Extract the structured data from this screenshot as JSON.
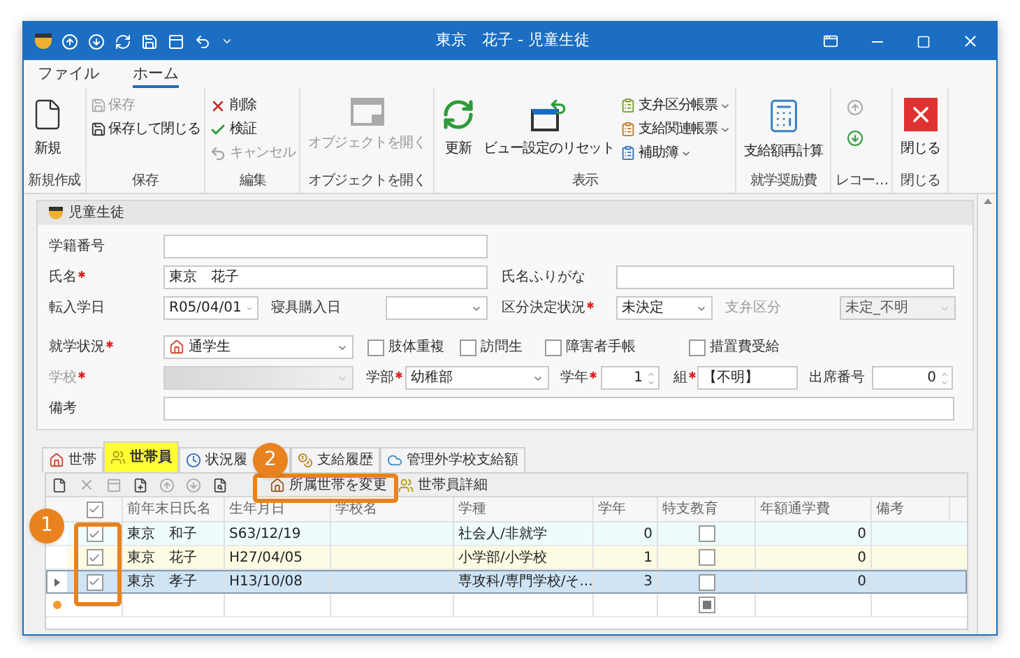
{
  "window": {
    "title": "東京　花子 - 児童生徒"
  },
  "menu_tabs": [
    {
      "label": "ファイル",
      "selected": false
    },
    {
      "label": "ホーム",
      "selected": true
    }
  ],
  "ribbon": [
    {
      "label": "新規作成",
      "items": [
        {
          "label": "新規",
          "kind": "large",
          "disabled": false
        }
      ]
    },
    {
      "label": "保存",
      "items": [
        {
          "label": "保存",
          "kind": "small",
          "disabled": true
        },
        {
          "label": "保存して閉じる",
          "kind": "small",
          "disabled": false
        }
      ]
    },
    {
      "label": "編集",
      "items": [
        {
          "label": "削除",
          "kind": "small",
          "disabled": false
        },
        {
          "label": "検証",
          "kind": "small",
          "disabled": false
        },
        {
          "label": "キャンセル",
          "kind": "small",
          "disabled": true
        }
      ]
    },
    {
      "label": "オブジェクトを開く",
      "items": [
        {
          "label": "オブジェクトを開く",
          "kind": "large",
          "disabled": true
        }
      ]
    },
    {
      "label": "表示",
      "items": [
        {
          "label": "更新",
          "kind": "large",
          "disabled": false
        },
        {
          "label": "ビュー設定のリセット",
          "kind": "large",
          "disabled": false
        },
        {
          "label": "支弁区分帳票",
          "kind": "small",
          "disabled": false,
          "dropdown": true
        },
        {
          "label": "支給関連帳票",
          "kind": "small",
          "disabled": false,
          "dropdown": true
        },
        {
          "label": "補助簿",
          "kind": "small",
          "disabled": false,
          "dropdown": true
        }
      ]
    },
    {
      "label": "就学奨励費",
      "items": [
        {
          "label": "支給額再計算",
          "kind": "large",
          "disabled": false
        }
      ]
    },
    {
      "label": "レコー…",
      "items": [
        {
          "kind": "iconsmall",
          "disabled": true
        },
        {
          "kind": "iconsmall",
          "disabled": false
        }
      ]
    },
    {
      "label": "閉じる",
      "items": [
        {
          "label": "閉じる",
          "kind": "large",
          "disabled": false
        }
      ]
    }
  ],
  "form": {
    "title": "児童生徒",
    "student_number": {
      "label": "学籍番号"
    },
    "name": {
      "label": "氏名",
      "required": true,
      "value": "東京　花子"
    },
    "name_kana": {
      "label": "氏名ふりがな"
    },
    "transfer_date": {
      "label": "転入学日",
      "value": "R05/04/01"
    },
    "bedding_date": {
      "label": "寝具購入日"
    },
    "category_status": {
      "label": "区分決定状況",
      "required": true,
      "value": "未決定"
    },
    "payment_category": {
      "label": "支弁区分",
      "value": "未定_不明",
      "disabled": true
    },
    "enrollment": {
      "label": "就学状況",
      "required": true,
      "value": "通学生"
    },
    "checks": [
      {
        "label": "肢体重複",
        "checked": false
      },
      {
        "label": "訪問生",
        "checked": false
      },
      {
        "label": "障害者手帳",
        "checked": false
      },
      {
        "label": "措置費受給",
        "checked": false
      }
    ],
    "school": {
      "label": "学校",
      "required": true,
      "disabled": true
    },
    "department": {
      "label": "学部",
      "required": true,
      "value": "幼稚部"
    },
    "grade": {
      "label": "学年",
      "required": true,
      "value": "1"
    },
    "class": {
      "label": "組",
      "required": true,
      "value": "【不明】"
    },
    "seat": {
      "label": "出席番号",
      "value": "0"
    },
    "notes": {
      "label": "備考"
    }
  },
  "sub_tabs": [
    {
      "label": "世帯",
      "selected": false
    },
    {
      "label": "世帯員",
      "selected": true
    },
    {
      "label": "状況履",
      "selected": false
    },
    {
      "label": "支給履歴",
      "selected": false
    },
    {
      "label": "管理外学校支給額",
      "selected": false
    }
  ],
  "toolbar": {
    "buttons": [
      {
        "label": "所属世帯を変更"
      },
      {
        "label": "世帯員詳細"
      }
    ]
  },
  "grid": {
    "header_checked": true,
    "columns": [
      "前年末日氏名",
      "生年月日",
      "学校名",
      "学種",
      "学年",
      "特支教育",
      "年額通学費",
      "備考"
    ],
    "rows": [
      {
        "checked": true,
        "selected": false,
        "color": "#eefcfd",
        "cells": [
          "東京　和子",
          "S63/12/19",
          "",
          "社会人/非就学",
          "0"
        ],
        "special_ed": false,
        "fee": "0"
      },
      {
        "checked": true,
        "selected": false,
        "color": "#fdfbe3",
        "cells": [
          "東京　花子",
          "H27/04/05",
          "",
          "小学部/小学校",
          "1"
        ],
        "special_ed": false,
        "fee": "0"
      },
      {
        "checked": true,
        "selected": true,
        "color": "#cfe4f5",
        "cells": [
          "東京　孝子",
          "H13/10/08",
          "",
          "専攻科/専門学校/そ...",
          "3"
        ],
        "special_ed": false,
        "fee": "0"
      }
    ],
    "new_row": {
      "special_ed_indeterminate": true
    }
  },
  "annotations": [
    {
      "label": "1"
    },
    {
      "label": "2"
    }
  ]
}
